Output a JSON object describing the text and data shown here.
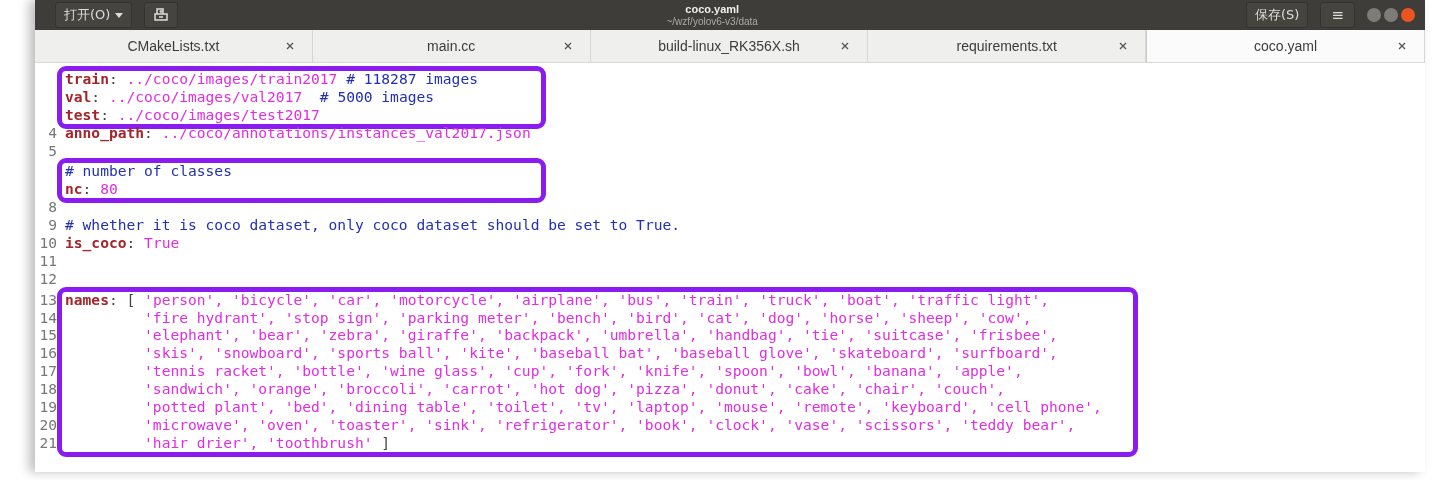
{
  "header": {
    "open_button": "打开(O)",
    "title": "coco.yaml",
    "subtitle": "~/wzf/yolov6-v3/data",
    "save_button": "保存(S)",
    "menu_button": "≡"
  },
  "tabs": [
    {
      "label": "CMakeLists.txt",
      "selected": false
    },
    {
      "label": "main.cc",
      "selected": false
    },
    {
      "label": "build-linux_RK356X.sh",
      "selected": false
    },
    {
      "label": "requirements.txt",
      "selected": false
    },
    {
      "label": "coco.yaml",
      "selected": true
    }
  ],
  "editor": {
    "blocks": [
      {
        "boxed": true,
        "lines": [
          {
            "segments": [
              {
                "kind": "key",
                "text": "train"
              },
              {
                "kind": "punct",
                "text": ": "
              },
              {
                "kind": "string",
                "text": "../coco/images/train2017"
              },
              {
                "kind": "comment",
                "text": " # 118287 images"
              }
            ]
          },
          {
            "segments": [
              {
                "kind": "key",
                "text": "val"
              },
              {
                "kind": "punct",
                "text": ": "
              },
              {
                "kind": "string",
                "text": "../coco/images/val2017"
              },
              {
                "kind": "comment",
                "text": "  # 5000 images"
              }
            ]
          },
          {
            "segments": [
              {
                "kind": "key",
                "text": "test"
              },
              {
                "kind": "punct",
                "text": ": "
              },
              {
                "kind": "string",
                "text": "../coco/images/test2017"
              }
            ]
          }
        ]
      },
      {
        "boxed": false,
        "lines": [
          {
            "number": "4",
            "segments": [
              {
                "kind": "key",
                "text": "anno_path"
              },
              {
                "kind": "punct",
                "text": ": "
              },
              {
                "kind": "string",
                "text": "../coco/annotations/instances_val2017.json"
              }
            ]
          },
          {
            "number": "5"
          }
        ]
      },
      {
        "boxed": true,
        "lines": [
          {
            "segments": [
              {
                "kind": "comment",
                "text": "# number of classes"
              }
            ]
          },
          {
            "segments": [
              {
                "kind": "key",
                "text": "nc"
              },
              {
                "kind": "punct",
                "text": ": "
              },
              {
                "kind": "string",
                "text": "80"
              }
            ]
          }
        ]
      },
      {
        "boxed": false,
        "lines": [
          {
            "number": "8"
          },
          {
            "number": "9",
            "segments": [
              {
                "kind": "comment",
                "text": "# whether it is coco dataset, only coco dataset should be set to True."
              }
            ]
          },
          {
            "number": "10",
            "segments": [
              {
                "kind": "key",
                "text": "is_coco"
              },
              {
                "kind": "punct",
                "text": ": "
              },
              {
                "kind": "string",
                "text": "True"
              }
            ]
          },
          {
            "number": "11"
          },
          {
            "number": "12"
          }
        ]
      },
      {
        "boxed": true,
        "lines": [
          {
            "number": "13",
            "segments": [
              {
                "kind": "key",
                "text": "names"
              },
              {
                "kind": "punct",
                "text": ": [ "
              },
              {
                "kind": "string",
                "text": "'person', 'bicycle', 'car', 'motorcycle', 'airplane', 'bus', 'train', 'truck', 'boat', 'traffic light',"
              }
            ]
          },
          {
            "number": "14",
            "indented": true,
            "segments": [
              {
                "kind": "string",
                "text": "'fire hydrant', 'stop sign', 'parking meter', 'bench', 'bird', 'cat', 'dog', 'horse', 'sheep', 'cow',"
              }
            ]
          },
          {
            "number": "15",
            "indented": true,
            "segments": [
              {
                "kind": "string",
                "text": "'elephant', 'bear', 'zebra', 'giraffe', 'backpack', 'umbrella', 'handbag', 'tie', 'suitcase', 'frisbee',"
              }
            ]
          },
          {
            "number": "16",
            "indented": true,
            "segments": [
              {
                "kind": "string",
                "text": "'skis', 'snowboard', 'sports ball', 'kite', 'baseball bat', 'baseball glove', 'skateboard', 'surfboard',"
              }
            ]
          },
          {
            "number": "17",
            "indented": true,
            "segments": [
              {
                "kind": "string",
                "text": "'tennis racket', 'bottle', 'wine glass', 'cup', 'fork', 'knife', 'spoon', 'bowl', 'banana', 'apple',"
              }
            ]
          },
          {
            "number": "18",
            "indented": true,
            "segments": [
              {
                "kind": "string",
                "text": "'sandwich', 'orange', 'broccoli', 'carrot', 'hot dog', 'pizza', 'donut', 'cake', 'chair', 'couch',"
              }
            ]
          },
          {
            "number": "19",
            "indented": true,
            "segments": [
              {
                "kind": "string",
                "text": "'potted plant', 'bed', 'dining table', 'toilet', 'tv', 'laptop', 'mouse', 'remote', 'keyboard', 'cell phone',"
              }
            ]
          },
          {
            "number": "20",
            "indented": true,
            "segments": [
              {
                "kind": "string",
                "text": "'microwave', 'oven', 'toaster', 'sink', 'refrigerator', 'book', 'clock', 'vase', 'scissors', 'teddy bear',"
              }
            ]
          },
          {
            "number": "21",
            "indented": true,
            "segments": [
              {
                "kind": "string",
                "text": "'hair drier', 'toothbrush' "
              },
              {
                "kind": "punct",
                "text": "]"
              }
            ]
          }
        ]
      }
    ]
  }
}
